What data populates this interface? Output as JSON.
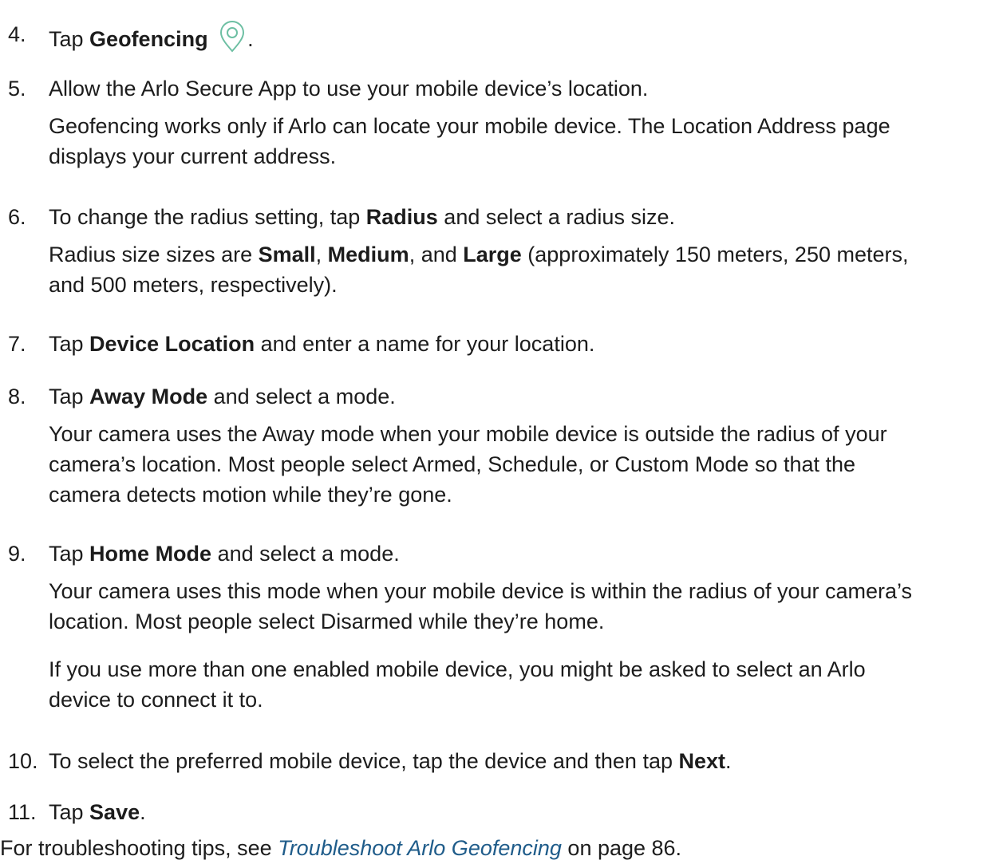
{
  "steps": [
    {
      "num": "4.",
      "pre": "Tap ",
      "bold": "Geofencing",
      "post": "."
    },
    {
      "num": "5.",
      "text": "Allow the Arlo Secure App to use your mobile device’s location.",
      "note_l1": "Geofencing works only if Arlo can locate your mobile device. The Location Address page",
      "note_l2": "displays your current address."
    },
    {
      "num": "6.",
      "pre": "To change the radius setting, tap ",
      "bold": "Radius",
      "post": " and select a radius size.",
      "note_pre": "Radius size sizes are ",
      "b1": "Small",
      "s1": ", ",
      "b2": "Medium",
      "s2": ", and ",
      "b3": "Large",
      "note_post": " (approximately 150 meters, 250 meters,",
      "note_l2": "and 500 meters, respectively)."
    },
    {
      "num": "7.",
      "pre": "Tap ",
      "bold": "Device Location",
      "post": " and enter a name for your location."
    },
    {
      "num": "8.",
      "pre": "Tap ",
      "bold": "Away Mode",
      "post": " and select a mode.",
      "note_l1": "Your camera uses the Away mode when your mobile device is outside the radius of your",
      "note_l2": "camera’s location. Most people select Armed, Schedule, or Custom Mode so that the",
      "note_l3": "camera detects motion while they’re gone."
    },
    {
      "num": "9.",
      "pre": "Tap ",
      "bold": "Home Mode",
      "post": " and select a mode.",
      "note_l1": "Your camera uses this mode when your mobile device is within the radius of your camera’s",
      "note_l2": "location. Most people select Disarmed while they’re home.",
      "note2_l1": "If you use more than one enabled mobile device, you might be asked to select an Arlo",
      "note2_l2": "device to connect it to."
    },
    {
      "num": "10.",
      "pre": "To select the preferred mobile device, tap the device and then tap ",
      "bold": "Next",
      "post": "."
    },
    {
      "num": "11.",
      "pre": "Tap ",
      "bold": "Save",
      "post": "."
    }
  ],
  "footer": {
    "pre": "For troubleshooting tips, see ",
    "link": "Troubleshoot Arlo Geofencing",
    "post": " on page 86."
  },
  "colors": {
    "accent": "#6dbfa3",
    "link": "#1f5c8a"
  },
  "icons": {
    "geofencing": "location-pin-icon"
  }
}
